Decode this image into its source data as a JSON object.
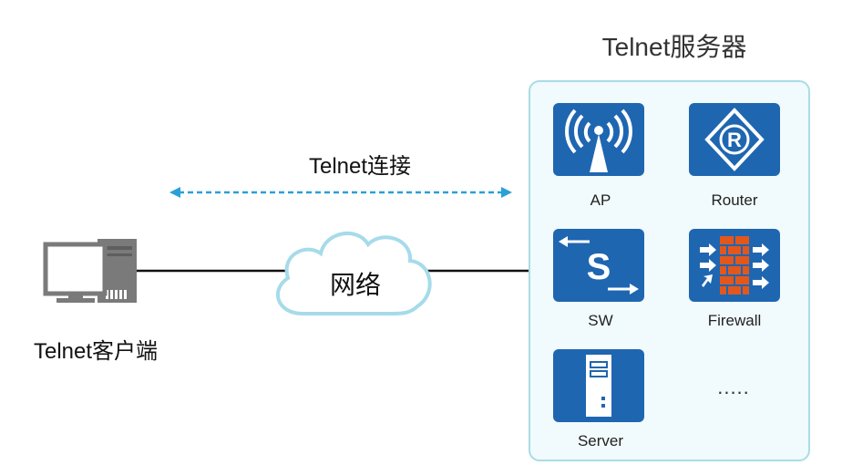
{
  "server": {
    "title": "Telnet服务器"
  },
  "connection": {
    "label": "Telnet连接"
  },
  "network": {
    "label": "网络"
  },
  "client": {
    "label": "Telnet客户端"
  },
  "devices": [
    {
      "icon": "ap-icon",
      "label": "AP"
    },
    {
      "icon": "router-icon",
      "label": "Router"
    },
    {
      "icon": "switch-icon",
      "label": "SW"
    },
    {
      "icon": "firewall-icon",
      "label": "Firewall"
    },
    {
      "icon": "server-icon",
      "label": "Server"
    }
  ],
  "more": "....."
}
